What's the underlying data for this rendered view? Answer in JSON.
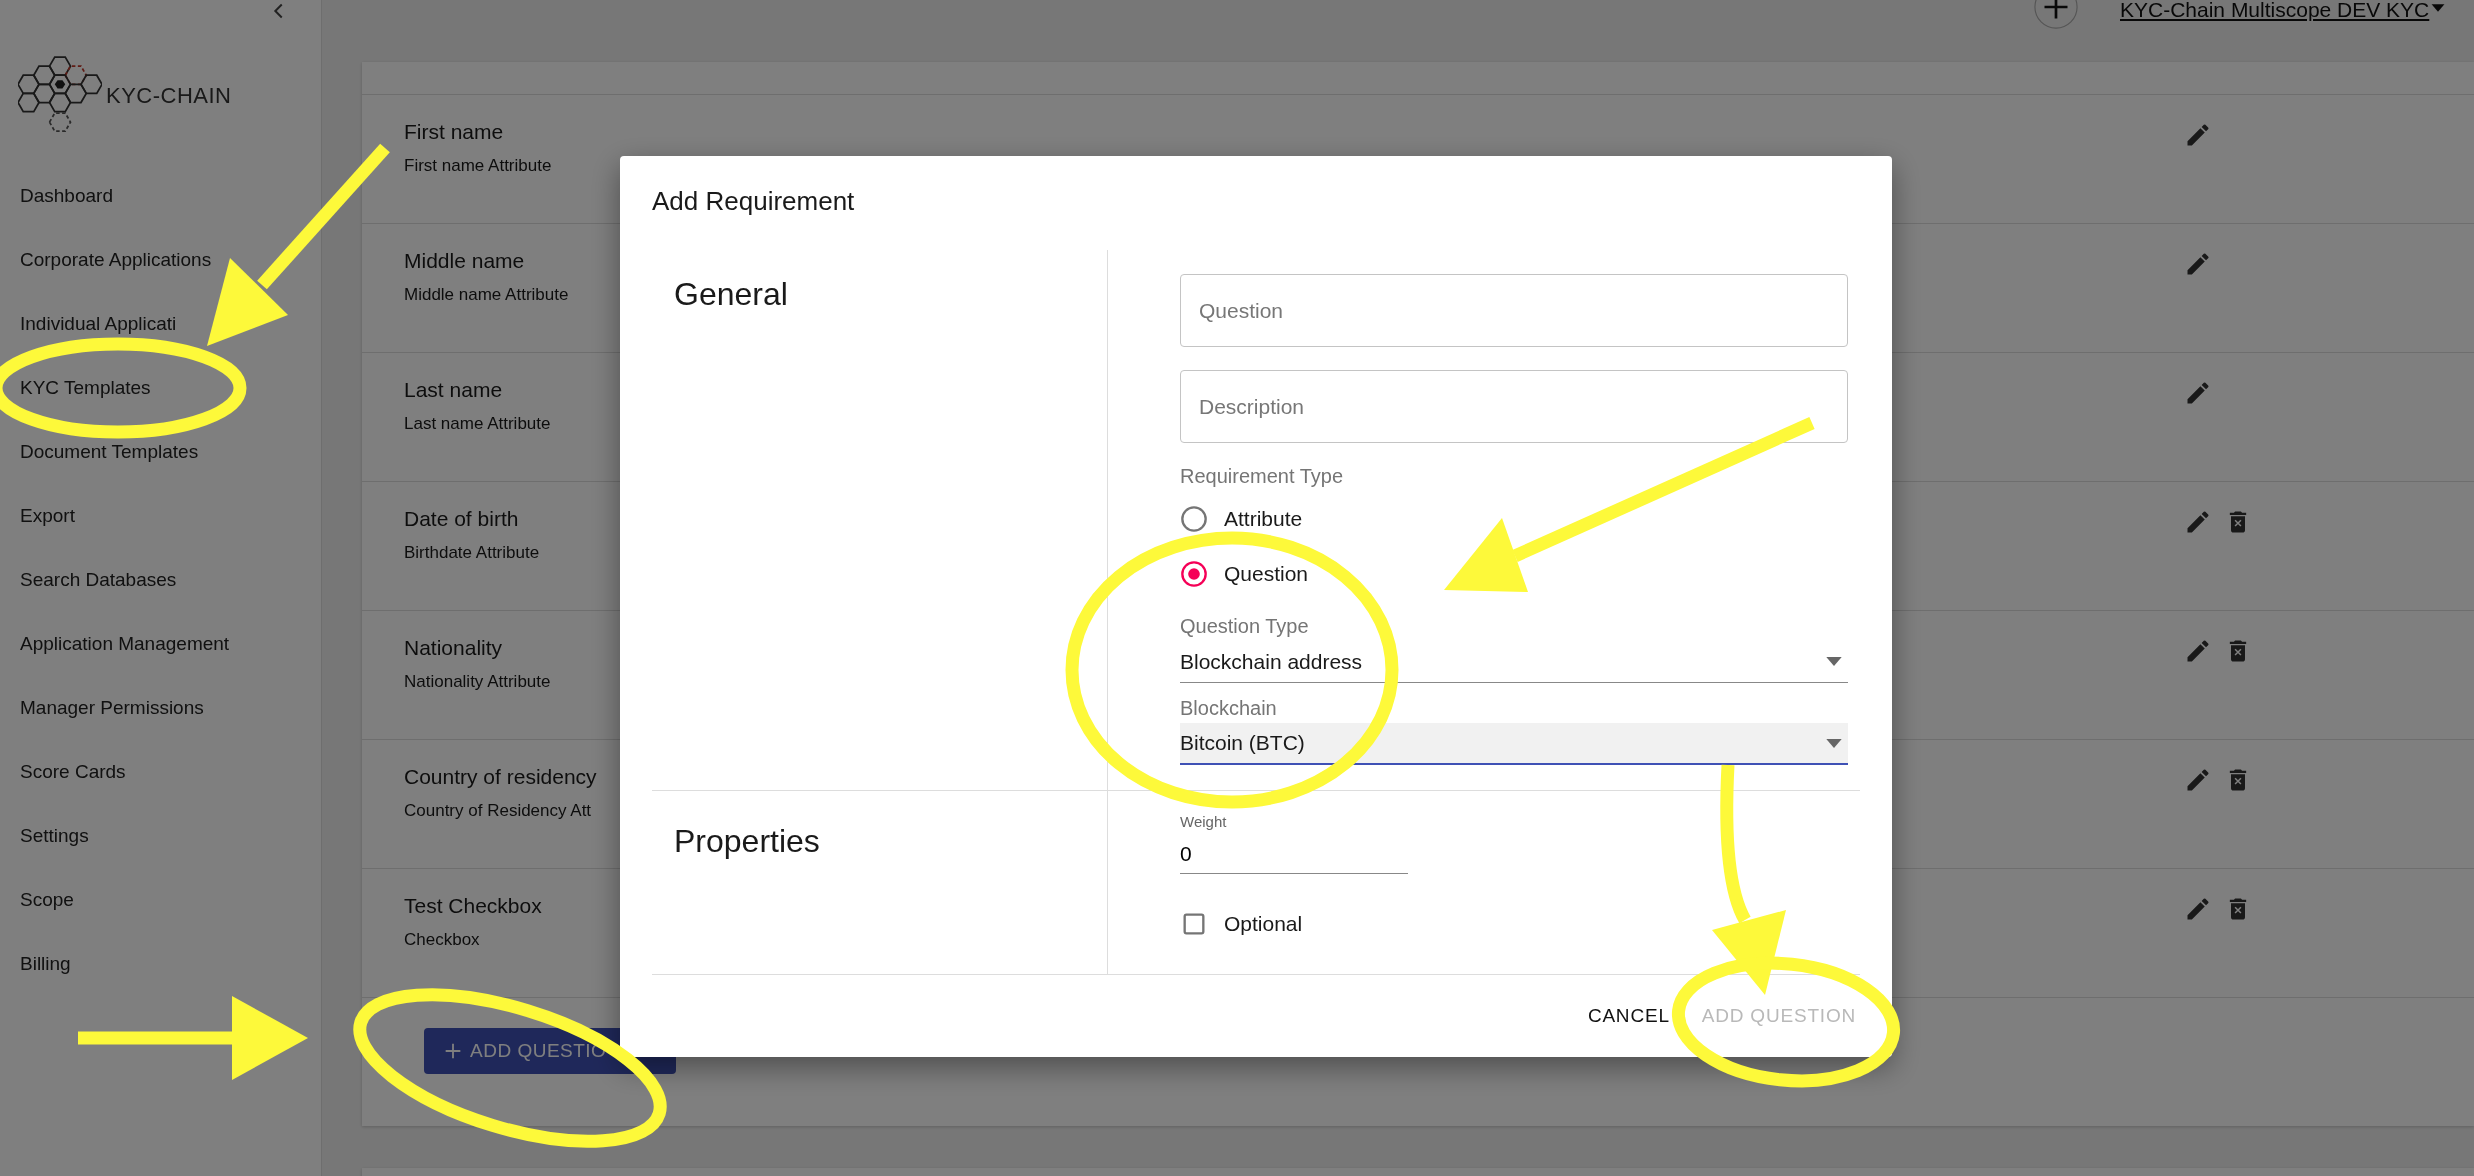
{
  "sidebar": {
    "logo_text": "KYC-CHAIN",
    "items": [
      {
        "label": "Dashboard"
      },
      {
        "label": "Corporate Applications"
      },
      {
        "label": "Individual Applicati"
      },
      {
        "label": "KYC Templates"
      },
      {
        "label": "Document Templates"
      },
      {
        "label": "Export"
      },
      {
        "label": "Search Databases"
      },
      {
        "label": "Application Management"
      },
      {
        "label": "Manager Permissions"
      },
      {
        "label": "Score Cards"
      },
      {
        "label": "Settings"
      },
      {
        "label": "Scope"
      },
      {
        "label": "Billing"
      }
    ]
  },
  "header": {
    "account": "KYC-Chain Multiscope DEV KYC"
  },
  "requirements": [
    {
      "title": "First name",
      "subtitle": "First name Attribute",
      "deletable": false
    },
    {
      "title": "Middle name",
      "subtitle": "Middle name Attribute",
      "deletable": false
    },
    {
      "title": "Last name",
      "subtitle": "Last name Attribute",
      "deletable": false
    },
    {
      "title": "Date of birth",
      "subtitle": "Birthdate Attribute",
      "deletable": true
    },
    {
      "title": "Nationality",
      "subtitle": "Nationality Attribute",
      "deletable": true
    },
    {
      "title": "Country of residency",
      "subtitle": "Country of Residency Att",
      "deletable": true
    },
    {
      "title": "Test Checkbox",
      "subtitle": "Checkbox",
      "deletable": true
    }
  ],
  "add_question_button": "ADD QUESTIO",
  "dialog": {
    "title": "Add Requirement",
    "general_heading": "General",
    "properties_heading": "Properties",
    "question": {
      "placeholder": "Question"
    },
    "description": {
      "placeholder": "Description"
    },
    "requirement_type": {
      "label": "Requirement Type",
      "options": [
        {
          "label": "Attribute",
          "selected": false
        },
        {
          "label": "Question",
          "selected": true
        }
      ]
    },
    "question_type": {
      "label": "Question Type",
      "value": "Blockchain address",
      "focused": false
    },
    "blockchain": {
      "label": "Blockchain",
      "value": "Bitcoin (BTC)",
      "focused": true
    },
    "weight": {
      "label": "Weight",
      "value": "0"
    },
    "optional": {
      "label": "Optional",
      "checked": false
    },
    "buttons": [
      {
        "label": "CANCEL",
        "disabled": false
      },
      {
        "label": "ADD QUESTION",
        "disabled": true
      }
    ]
  }
}
